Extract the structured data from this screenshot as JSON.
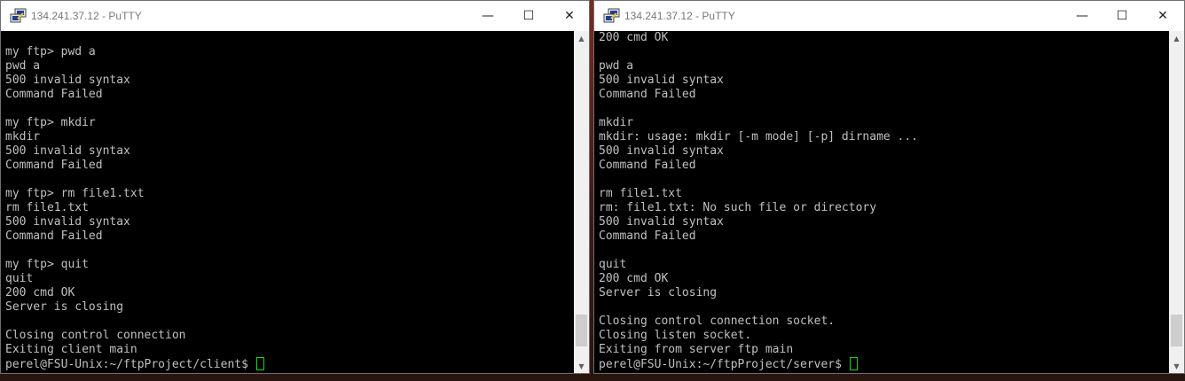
{
  "left_window": {
    "title": "134.241.37.12 - PuTTY",
    "controls": {
      "minimize": "—",
      "maximize": "☐",
      "close": "✕"
    },
    "lines": [
      "",
      "my ftp> pwd a",
      "pwd a",
      "500 invalid syntax",
      "Command Failed",
      "",
      "my ftp> mkdir",
      "mkdir",
      "500 invalid syntax",
      "Command Failed",
      "",
      "my ftp> rm file1.txt",
      "rm file1.txt",
      "500 invalid syntax",
      "Command Failed",
      "",
      "my ftp> quit",
      "quit",
      "200 cmd OK",
      "Server is closing",
      "",
      "Closing control connection",
      "Exiting client main"
    ],
    "prompt": "perel@FSU-Unix:~/ftpProject/client$ ",
    "scrollbar": {
      "up": "▲",
      "down": "▼",
      "thumb_start_fraction": 0.86,
      "thumb_size_fraction": 0.1
    }
  },
  "right_window": {
    "title": "134.241.37.12 - PuTTY",
    "controls": {
      "minimize": "—",
      "maximize": "☐",
      "close": "✕"
    },
    "lines": [
      "200 cmd OK",
      "",
      "pwd a",
      "500 invalid syntax",
      "Command Failed",
      "",
      "mkdir",
      "mkdir: usage: mkdir [-m mode] [-p] dirname ...",
      "500 invalid syntax",
      "Command Failed",
      "",
      "rm file1.txt",
      "rm: file1.txt: No such file or directory",
      "500 invalid syntax",
      "Command Failed",
      "",
      "quit",
      "200 cmd OK",
      "Server is closing",
      "",
      "Closing control connection socket.",
      "Closing listen socket.",
      "Exiting from server ftp main"
    ],
    "prompt": "perel@FSU-Unix:~/ftpProject/server$ ",
    "scrollbar": {
      "up": "▲",
      "down": "▼",
      "thumb_start_fraction": 0.86,
      "thumb_size_fraction": 0.1
    }
  },
  "colors": {
    "terminal_bg": "#000000",
    "terminal_fg": "#c0c0c0",
    "cursor": "#17d617",
    "titlebar": "#ffffff"
  }
}
